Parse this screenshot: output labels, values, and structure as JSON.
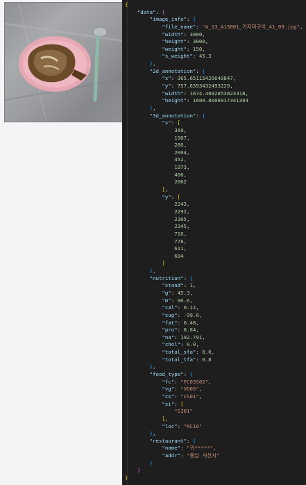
{
  "image_panel": {
    "alt": "food photo: grilled fish on a pink plate with a spoon"
  },
  "json_lines": [
    [
      [
        "b1",
        "{"
      ]
    ],
    [
      [
        "p",
        "    "
      ],
      [
        "k",
        "\"data\""
      ],
      [
        "p",
        ": "
      ],
      [
        "b2",
        "{"
      ]
    ],
    [
      [
        "p",
        "        "
      ],
      [
        "k",
        "\"image_info\""
      ],
      [
        "p",
        ": "
      ],
      [
        "b3",
        "{"
      ]
    ],
    [
      [
        "p",
        "            "
      ],
      [
        "k",
        "\"file_name\""
      ],
      [
        "p",
        ": "
      ],
      [
        "s",
        "\"A_13_A13001_가지미구이_41_09.jpg\""
      ],
      [
        "p",
        ","
      ]
    ],
    [
      [
        "p",
        "            "
      ],
      [
        "k",
        "\"width\""
      ],
      [
        "p",
        ": "
      ],
      [
        "n",
        "3000"
      ],
      [
        "p",
        ","
      ]
    ],
    [
      [
        "p",
        "            "
      ],
      [
        "k",
        "\"height\""
      ],
      [
        "p",
        ": "
      ],
      [
        "n",
        "3000"
      ],
      [
        "p",
        ","
      ]
    ],
    [
      [
        "p",
        "            "
      ],
      [
        "k",
        "\"weight\""
      ],
      [
        "p",
        ": "
      ],
      [
        "n",
        "150"
      ],
      [
        "p",
        ","
      ]
    ],
    [
      [
        "p",
        "            "
      ],
      [
        "k",
        "\"s_weight\""
      ],
      [
        "p",
        ": "
      ],
      [
        "n",
        "45.3"
      ]
    ],
    [
      [
        "p",
        "        "
      ],
      [
        "b3",
        "}"
      ],
      [
        "p",
        ","
      ]
    ],
    [
      [
        "p",
        "        "
      ],
      [
        "k",
        "\"2d_annotation\""
      ],
      [
        "p",
        ": "
      ],
      [
        "b3",
        "{"
      ]
    ],
    [
      [
        "p",
        "            "
      ],
      [
        "k",
        "\"x\""
      ],
      [
        "p",
        ": "
      ],
      [
        "n",
        "365.65115426640847"
      ],
      [
        "p",
        ","
      ]
    ],
    [
      [
        "p",
        "            "
      ],
      [
        "k",
        "\"y\""
      ],
      [
        "p",
        ": "
      ],
      [
        "n",
        "757.6393432493229"
      ],
      [
        "p",
        ","
      ]
    ],
    [
      [
        "p",
        "            "
      ],
      [
        "k",
        "\"width\""
      ],
      [
        "p",
        ": "
      ],
      [
        "n",
        "1674.4082853823318"
      ],
      [
        "p",
        ","
      ]
    ],
    [
      [
        "p",
        "            "
      ],
      [
        "k",
        "\"height\""
      ],
      [
        "p",
        ": "
      ],
      [
        "n",
        "1609.8008917341394"
      ]
    ],
    [
      [
        "p",
        "        "
      ],
      [
        "b3",
        "}"
      ],
      [
        "p",
        ","
      ]
    ],
    [
      [
        "p",
        "        "
      ],
      [
        "k",
        "\"3d_annotation\""
      ],
      [
        "p",
        ": "
      ],
      [
        "b3",
        "{"
      ]
    ],
    [
      [
        "p",
        "            "
      ],
      [
        "k",
        "\"x\""
      ],
      [
        "p",
        ": "
      ],
      [
        "b1",
        "["
      ]
    ],
    [
      [
        "p",
        "                "
      ],
      [
        "n",
        "369"
      ],
      [
        "p",
        ","
      ]
    ],
    [
      [
        "p",
        "                "
      ],
      [
        "n",
        "1907"
      ],
      [
        "p",
        ","
      ]
    ],
    [
      [
        "p",
        "                "
      ],
      [
        "n",
        "280"
      ],
      [
        "p",
        ","
      ]
    ],
    [
      [
        "p",
        "                "
      ],
      [
        "n",
        "2004"
      ],
      [
        "p",
        ","
      ]
    ],
    [
      [
        "p",
        "                "
      ],
      [
        "n",
        "452"
      ],
      [
        "p",
        ","
      ]
    ],
    [
      [
        "p",
        "                "
      ],
      [
        "n",
        "1973"
      ],
      [
        "p",
        ","
      ]
    ],
    [
      [
        "p",
        "                "
      ],
      [
        "n",
        "406"
      ],
      [
        "p",
        ","
      ]
    ],
    [
      [
        "p",
        "                "
      ],
      [
        "n",
        "2062"
      ]
    ],
    [
      [
        "p",
        "            "
      ],
      [
        "b1",
        "]"
      ],
      [
        "p",
        ","
      ]
    ],
    [
      [
        "p",
        "            "
      ],
      [
        "k",
        "\"y\""
      ],
      [
        "p",
        ": "
      ],
      [
        "b1",
        "["
      ]
    ],
    [
      [
        "p",
        "                "
      ],
      [
        "n",
        "2243"
      ],
      [
        "p",
        ","
      ]
    ],
    [
      [
        "p",
        "                "
      ],
      [
        "n",
        "2292"
      ],
      [
        "p",
        ","
      ]
    ],
    [
      [
        "p",
        "                "
      ],
      [
        "n",
        "2305"
      ],
      [
        "p",
        ","
      ]
    ],
    [
      [
        "p",
        "                "
      ],
      [
        "n",
        "2345"
      ],
      [
        "p",
        ","
      ]
    ],
    [
      [
        "p",
        "                "
      ],
      [
        "n",
        "716"
      ],
      [
        "p",
        ","
      ]
    ],
    [
      [
        "p",
        "                "
      ],
      [
        "n",
        "778"
      ],
      [
        "p",
        ","
      ]
    ],
    [
      [
        "p",
        "                "
      ],
      [
        "n",
        "611"
      ],
      [
        "p",
        ","
      ]
    ],
    [
      [
        "p",
        "                "
      ],
      [
        "n",
        "694"
      ]
    ],
    [
      [
        "p",
        "            "
      ],
      [
        "b1",
        "]"
      ]
    ],
    [
      [
        "p",
        "        "
      ],
      [
        "b3",
        "}"
      ],
      [
        "p",
        ","
      ]
    ],
    [
      [
        "p",
        "        "
      ],
      [
        "k",
        "\"nutrition\""
      ],
      [
        "p",
        ": "
      ],
      [
        "b3",
        "{"
      ]
    ],
    [
      [
        "p",
        "            "
      ],
      [
        "k",
        "\"stand\""
      ],
      [
        "p",
        ": "
      ],
      [
        "n",
        "1"
      ],
      [
        "p",
        ","
      ]
    ],
    [
      [
        "p",
        "            "
      ],
      [
        "k",
        "\"g\""
      ],
      [
        "p",
        ": "
      ],
      [
        "n",
        "45.3"
      ],
      [
        "p",
        ","
      ]
    ],
    [
      [
        "p",
        "            "
      ],
      [
        "k",
        "\"m\""
      ],
      [
        "p",
        ": "
      ],
      [
        "n",
        "96.6"
      ],
      [
        "p",
        ","
      ]
    ],
    [
      [
        "p",
        "            "
      ],
      [
        "k",
        "\"cal\""
      ],
      [
        "p",
        ": "
      ],
      [
        "n",
        "0.12"
      ],
      [
        "p",
        ","
      ]
    ],
    [
      [
        "p",
        "            "
      ],
      [
        "k",
        "\"sug\""
      ],
      [
        "p",
        ": "
      ],
      [
        "n",
        "-99.0"
      ],
      [
        "p",
        ","
      ]
    ],
    [
      [
        "p",
        "            "
      ],
      [
        "k",
        "\"fat\""
      ],
      [
        "p",
        ": "
      ],
      [
        "n",
        "6.48"
      ],
      [
        "p",
        ","
      ]
    ],
    [
      [
        "p",
        "            "
      ],
      [
        "k",
        "\"pro\""
      ],
      [
        "p",
        ": "
      ],
      [
        "n",
        "8.84"
      ],
      [
        "p",
        ","
      ]
    ],
    [
      [
        "p",
        "            "
      ],
      [
        "k",
        "\"na\""
      ],
      [
        "p",
        ": "
      ],
      [
        "n",
        "192.791"
      ],
      [
        "p",
        ","
      ]
    ],
    [
      [
        "p",
        "            "
      ],
      [
        "k",
        "\"chol\""
      ],
      [
        "p",
        ": "
      ],
      [
        "n",
        "0.0"
      ],
      [
        "p",
        ","
      ]
    ],
    [
      [
        "p",
        "            "
      ],
      [
        "k",
        "\"total_sfa\""
      ],
      [
        "p",
        ": "
      ],
      [
        "n",
        "0.0"
      ],
      [
        "p",
        ","
      ]
    ],
    [
      [
        "p",
        "            "
      ],
      [
        "k",
        "\"total_tfa\""
      ],
      [
        "p",
        ": "
      ],
      [
        "n",
        "0.8"
      ]
    ],
    [
      [
        "p",
        "        "
      ],
      [
        "b3",
        "}"
      ],
      [
        "p",
        ","
      ]
    ],
    [
      [
        "p",
        "        "
      ],
      [
        "k",
        "\"food_type\""
      ],
      [
        "p",
        ": "
      ],
      [
        "b3",
        "{"
      ]
    ],
    [
      [
        "p",
        "            "
      ],
      [
        "k",
        "\"fc\""
      ],
      [
        "p",
        ": "
      ],
      [
        "s",
        "\"FC03S02\""
      ],
      [
        "p",
        ","
      ]
    ],
    [
      [
        "p",
        "            "
      ],
      [
        "k",
        "\"vg\""
      ],
      [
        "p",
        ": "
      ],
      [
        "s",
        "\"VG05\""
      ],
      [
        "p",
        ","
      ]
    ],
    [
      [
        "p",
        "            "
      ],
      [
        "k",
        "\"cs\""
      ],
      [
        "p",
        ": "
      ],
      [
        "s",
        "\"CS01\""
      ],
      [
        "p",
        ","
      ]
    ],
    [
      [
        "p",
        "            "
      ],
      [
        "k",
        "\"si\""
      ],
      [
        "p",
        ": "
      ],
      [
        "b1",
        "["
      ]
    ],
    [
      [
        "p",
        "                "
      ],
      [
        "s",
        "\"SI01\""
      ]
    ],
    [
      [
        "p",
        "            "
      ],
      [
        "b1",
        "]"
      ],
      [
        "p",
        ","
      ]
    ],
    [
      [
        "p",
        "            "
      ],
      [
        "k",
        "\"loc\""
      ],
      [
        "p",
        ": "
      ],
      [
        "s",
        "\"RC10\""
      ]
    ],
    [
      [
        "p",
        "        "
      ],
      [
        "b3",
        "}"
      ],
      [
        "p",
        ","
      ]
    ],
    [
      [
        "p",
        "        "
      ],
      [
        "k",
        "\"restaurant\""
      ],
      [
        "p",
        ": "
      ],
      [
        "b3",
        "{"
      ]
    ],
    [
      [
        "p",
        "            "
      ],
      [
        "k",
        "\"name\""
      ],
      [
        "p",
        ": "
      ],
      [
        "s",
        "\"귀*****\""
      ],
      [
        "p",
        ","
      ]
    ],
    [
      [
        "p",
        "            "
      ],
      [
        "k",
        "\"addr\""
      ],
      [
        "p",
        ": "
      ],
      [
        "s",
        "\"충남 서산시\""
      ]
    ],
    [
      [
        "p",
        "        "
      ],
      [
        "b3",
        "}"
      ]
    ],
    [
      [
        "p",
        "    "
      ],
      [
        "b2",
        "}"
      ]
    ],
    [
      [
        "b1",
        "}"
      ]
    ]
  ]
}
